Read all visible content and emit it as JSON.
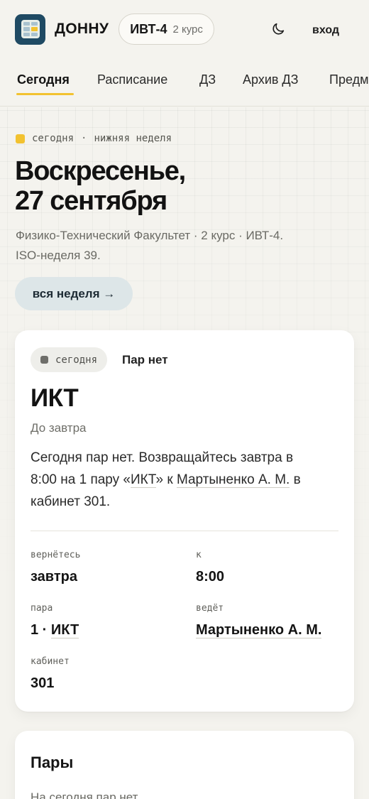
{
  "header": {
    "brand": "ДОННУ",
    "group": {
      "name": "ИВТ-4",
      "year": "2 курс"
    },
    "theme_icon": "moon-icon",
    "login_label": "вход"
  },
  "tabs": [
    {
      "label": "Сегодня",
      "active": true
    },
    {
      "label": "Расписание",
      "active": false
    },
    {
      "label": "ДЗ",
      "active": false
    },
    {
      "label": "Архив ДЗ",
      "active": false
    },
    {
      "label": "Предметы",
      "active": false
    }
  ],
  "hero": {
    "eyebrow_day": "сегодня",
    "eyebrow_sep": "·",
    "eyebrow_week": "нижняя неделя",
    "title_line1": "Воскресенье,",
    "title_line2": "27 сентября",
    "subtitle_line1": "Физико-Технический Факультет · 2 курс · ИВТ-4.",
    "subtitle_line2": "ISO-неделя 39.",
    "week_button": "вся неделя →"
  },
  "status_card": {
    "chip": "сегодня",
    "status": "Пар нет",
    "subject": "ИКТ",
    "until": "До завтра",
    "desc": {
      "p1": "Сегодня пар нет. Возвращайтесь завтра в",
      "p2": "8:00 на 1 пару «",
      "subject_link": "ИКТ",
      "p3": "» к ",
      "teacher_link": "Мартыненко А. М.",
      "p4": " в",
      "p5": "кабинет 301."
    },
    "fields": {
      "return_label": "вернётесь",
      "return_value": "завтра",
      "at_label": "к",
      "at_value": "8:00",
      "pair_label": "пара",
      "pair_number": "1 ·",
      "pair_subject": "ИКТ",
      "teacher_label": "ведёт",
      "teacher_value": "Мартыненко А. М.",
      "room_label": "кабинет",
      "room_value": "301"
    }
  },
  "pairs_card": {
    "title": "Пары",
    "empty_text": "На сегодня пар нет."
  },
  "colors": {
    "accent": "#f2c230",
    "logo_bg": "#1f4a63",
    "page_bg": "#f4f3ee",
    "week_button_bg": "#dde6e8"
  }
}
